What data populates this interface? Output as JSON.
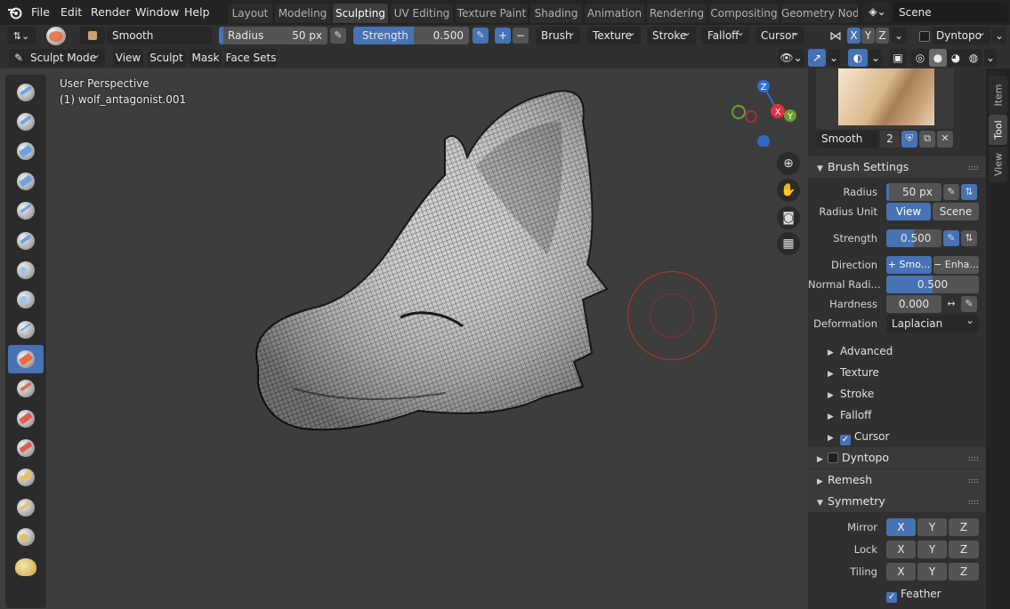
{
  "menubar": {
    "file": "File",
    "edit": "Edit",
    "render": "Render",
    "window": "Window",
    "help": "Help"
  },
  "workspaces": [
    "Layout",
    "Modeling",
    "Sculpting",
    "UV Editing",
    "Texture Paint",
    "Shading",
    "Animation",
    "Rendering",
    "Compositing",
    "Geometry Nod"
  ],
  "scene": {
    "name": "Scene"
  },
  "toolheader": {
    "brush_name": "Smooth",
    "radius_label": "Radius",
    "radius_value": "50 px",
    "strength_label": "Strength",
    "strength_value": "0.500",
    "strength_fraction": 0.52,
    "plus": "+",
    "minus": "−",
    "brush_menu": "Brush",
    "texture_menu": "Texture",
    "stroke_menu": "Stroke",
    "falloff_menu": "Falloff",
    "cursor_menu": "Cursor",
    "axis_x": "X",
    "axis_y": "Y",
    "axis_z": "Z",
    "dyntopo": "Dyntopo"
  },
  "viewheader": {
    "mode": "Sculpt Mode",
    "view": "View",
    "sculpt": "Sculpt",
    "mask": "Mask",
    "face_sets": "Face Sets"
  },
  "viewport": {
    "perspective": "User Perspective",
    "object": "(1) wolf_antagonist.001",
    "gizmo_x": "X",
    "gizmo_y": "Y",
    "gizmo_z": "Z"
  },
  "tabs": {
    "item": "Item",
    "tool": "Tool",
    "view": "View"
  },
  "brush": {
    "name": "Smooth",
    "users": "2"
  },
  "brush_settings": {
    "title": "Brush Settings",
    "radius_label": "Radius",
    "radius_value": "50 px",
    "radius_fraction": 0.05,
    "radius_unit_label": "Radius Unit",
    "unit_view": "View",
    "unit_scene": "Scene",
    "strength_label": "Strength",
    "strength_value": "0.500",
    "strength_fraction": 0.5,
    "direction_label": "Direction",
    "dir_smooth": "+ Smo...",
    "dir_enhance": "− Enha...",
    "normal_radius_label": "Normal Radi...",
    "normal_radius_value": "0.500",
    "normal_radius_fraction": 0.5,
    "hardness_label": "Hardness",
    "hardness_value": "0.000",
    "deformation_label": "Deformation",
    "deformation_value": "Laplacian"
  },
  "subpanels": {
    "advanced": "Advanced",
    "texture": "Texture",
    "stroke": "Stroke",
    "falloff": "Falloff",
    "cursor": "Cursor"
  },
  "sections": {
    "dyntopo": "Dyntopo",
    "remesh": "Remesh",
    "symmetry": "Symmetry"
  },
  "symmetry": {
    "mirror_label": "Mirror",
    "lock_label": "Lock",
    "tiling_label": "Tiling",
    "x": "X",
    "y": "Y",
    "z": "Z",
    "feather": "Feather"
  }
}
